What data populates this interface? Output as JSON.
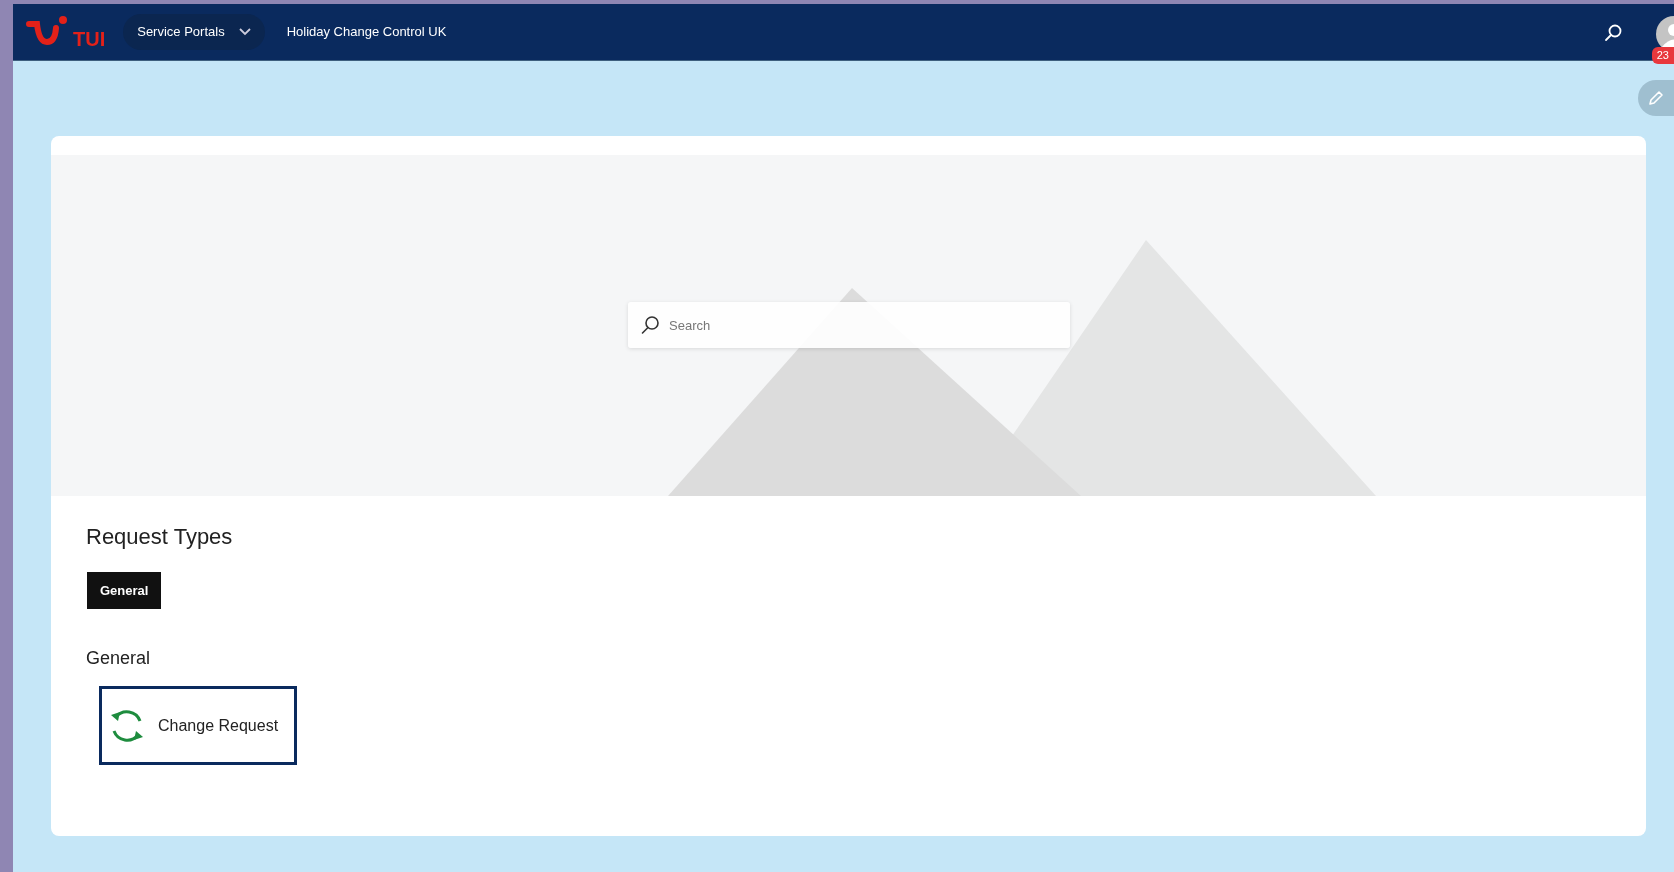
{
  "header": {
    "logo_text": "TUI",
    "nav": [
      {
        "kind": "dropdown",
        "label": "Service Portals"
      },
      {
        "kind": "link",
        "label": "Holiday Change Control UK"
      }
    ],
    "notification_count": "23"
  },
  "hero": {
    "search": {
      "placeholder": "Search"
    }
  },
  "request_types": {
    "title": "Request Types",
    "tabs": [
      {
        "label": "General",
        "selected": true
      }
    ],
    "groups": [
      {
        "heading": "General",
        "items": [
          {
            "label": "Change Request"
          }
        ]
      }
    ]
  }
}
